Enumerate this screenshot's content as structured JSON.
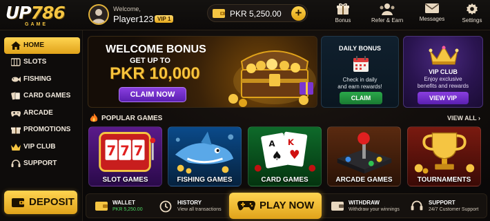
{
  "logo": {
    "brand_white": "UP",
    "brand_gold": "786",
    "tagline": "GAME"
  },
  "user": {
    "welcome": "Welcome,",
    "name": "Player123",
    "vip_badge": "VIP 1"
  },
  "balance": {
    "text": "PKR 5,250.00",
    "add": "+"
  },
  "header_nav": [
    {
      "label": "Bonus",
      "icon": "gift-icon"
    },
    {
      "label": "Refer & Earn",
      "icon": "users-icon"
    },
    {
      "label": "Messages",
      "icon": "mail-icon"
    },
    {
      "label": "Settings",
      "icon": "gear-icon"
    }
  ],
  "sidebar": {
    "items": [
      {
        "label": "HOME",
        "icon": "home-icon",
        "active": true
      },
      {
        "label": "SLOTS",
        "icon": "slots-icon",
        "active": false
      },
      {
        "label": "FISHING",
        "icon": "fish-icon",
        "active": false
      },
      {
        "label": "CARD GAMES",
        "icon": "cards-icon",
        "active": false
      },
      {
        "label": "ARCADE",
        "icon": "gamepad-icon",
        "active": false
      },
      {
        "label": "PROMOTIONS",
        "icon": "gift-icon",
        "active": false
      },
      {
        "label": "VIP CLUB",
        "icon": "crown-icon",
        "active": false
      },
      {
        "label": "SUPPORT",
        "icon": "headset-icon",
        "active": false
      }
    ],
    "deposit": "DEPOSIT"
  },
  "welcome_banner": {
    "title": "WELCOME BONUS",
    "subtitle": "GET UP TO",
    "amount": "PKR 10,000",
    "button": "CLAIM NOW"
  },
  "daily_bonus": {
    "title": "DAILY BONUS",
    "desc_line1": "Check in daily",
    "desc_line2": "and earn rewards!",
    "button": "CLAIM"
  },
  "vip_club": {
    "title": "VIP CLUB",
    "desc_line1": "Enjoy exclusive",
    "desc_line2": "benefits and rewards",
    "button": "VIEW VIP"
  },
  "popular": {
    "title": "POPULAR GAMES",
    "view_all": "VIEW ALL",
    "games": [
      {
        "label": "SLOT GAMES"
      },
      {
        "label": "FISHING GAMES"
      },
      {
        "label": "CARD GAMES"
      },
      {
        "label": "ARCADE GAMES"
      },
      {
        "label": "TOURNAMENTS"
      }
    ]
  },
  "bottom_bar": {
    "wallet": {
      "title": "WALLET",
      "sub": "PKR 5,250.00"
    },
    "history": {
      "title": "HISTORY",
      "sub": "View all transactions"
    },
    "play": "PLAY NOW",
    "withdraw": {
      "title": "WITHDRAW",
      "sub": "Withdraw your winnings"
    },
    "support": {
      "title": "SUPPORT",
      "sub": "24/7 Customer Support"
    }
  },
  "colors": {
    "accent_gold": "#f5c542",
    "purple": "#7a35d0",
    "green": "#2aa84a",
    "background": "#0a0808"
  }
}
